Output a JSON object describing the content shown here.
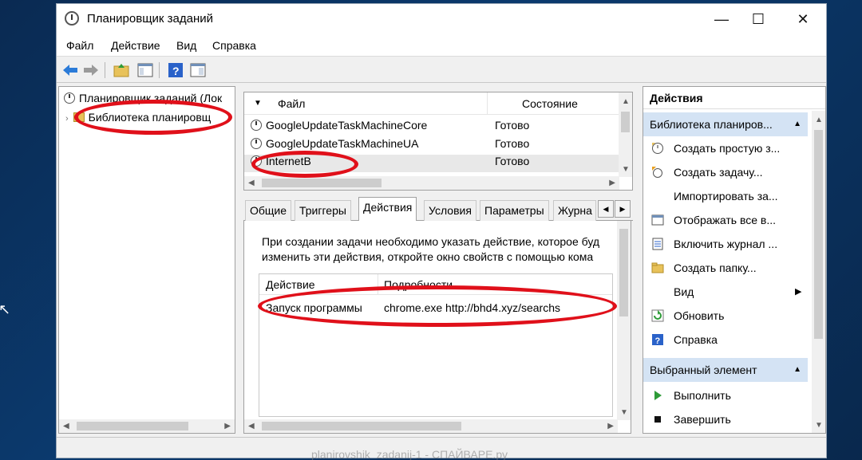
{
  "window": {
    "title": "Планировщик заданий",
    "controls": {
      "minimize": "—",
      "maximize": "☐",
      "close": "✕"
    }
  },
  "menu": [
    "Файл",
    "Действие",
    "Вид",
    "Справка"
  ],
  "toolbar": {
    "icons": [
      "back-icon",
      "forward-icon",
      "up-folder-icon",
      "show-hide-console-tree-icon",
      "help-icon",
      "properties-icon"
    ]
  },
  "tree": {
    "root": "Планировщик заданий (Лок",
    "library": "Библиотека планировщ"
  },
  "task_list": {
    "headers": {
      "name": "Файл",
      "status": "Состояние"
    },
    "rows": [
      {
        "name": "GoogleUpdateTaskMachineCore",
        "status": "Готово"
      },
      {
        "name": "GoogleUpdateTaskMachineUA",
        "status": "Готово"
      },
      {
        "name": "InternetB",
        "status": "Готово"
      }
    ]
  },
  "details": {
    "tabs": [
      "Общие",
      "Триггеры",
      "Действия",
      "Условия",
      "Параметры",
      "Журна"
    ],
    "active_tab": "Действия",
    "info_line1": "При создании задачи необходимо указать действие, которое буд",
    "info_line2": "изменить эти действия, откройте окно свойств с помощью кома",
    "table": {
      "headers": {
        "action": "Действие",
        "details": "Подробности"
      },
      "rows": [
        {
          "action": "Запуск программы",
          "details": "chrome.exe http://bhd4.xyz/searchs"
        }
      ]
    }
  },
  "actions_pane": {
    "title": "Действия",
    "section1": "Библиотека планиров...",
    "items1": [
      {
        "label": "Создать простую з...",
        "icon": "create-basic-task-icon"
      },
      {
        "label": "Создать задачу...",
        "icon": "create-task-icon"
      },
      {
        "label": "Импортировать за...",
        "icon": ""
      },
      {
        "label": "Отображать все в...",
        "icon": "display-running-icon"
      },
      {
        "label": "Включить журнал ...",
        "icon": "enable-history-icon"
      },
      {
        "label": "Создать папку...",
        "icon": "new-folder-icon"
      },
      {
        "label": "Вид",
        "icon": ""
      },
      {
        "label": "Обновить",
        "icon": "refresh-icon"
      },
      {
        "label": "Справка",
        "icon": "help-icon"
      }
    ],
    "section2": "Выбранный элемент",
    "items2": [
      {
        "label": "Выполнить",
        "icon": "run-icon"
      },
      {
        "label": "Завершить",
        "icon": "end-icon"
      }
    ]
  },
  "watermark": "planirovshik_zadanij-1 - СПАЙВАРЕ.ру",
  "colors": {
    "highlight_ellipse": "#e0101a",
    "section_bg": "#d4e3f4"
  }
}
